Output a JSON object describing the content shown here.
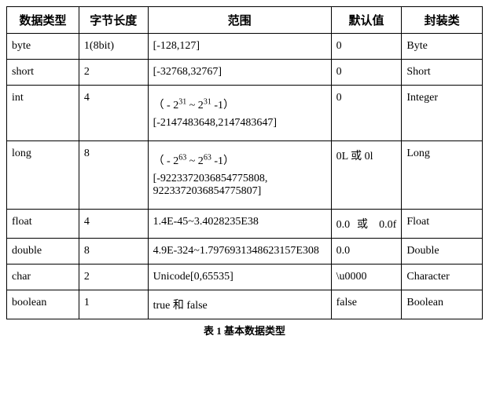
{
  "chart_data": {
    "type": "table",
    "title": "表 1  基本数据类型",
    "columns": [
      "数据类型",
      "字节长度",
      "范围",
      "默认值",
      "封装类"
    ],
    "rows": [
      {
        "type": "byte",
        "bytes": "1(8bit)",
        "range": "[-128,127]",
        "default": "0",
        "wrapper": "Byte"
      },
      {
        "type": "short",
        "bytes": "2",
        "range": "[-32768,32767]",
        "default": "0",
        "wrapper": "Short"
      },
      {
        "type": "int",
        "bytes": "4",
        "range_formula": "( - 2^31 ~ 2^31 -1)",
        "range_literal": "[-2147483648,2147483647]",
        "default": "0",
        "wrapper": "Integer"
      },
      {
        "type": "long",
        "bytes": "8",
        "range_formula": "( - 2^63 ~ 2^63  -1)",
        "range_literal": "[-9223372036854775808, 9223372036854775807]",
        "default": "0L 或 0l",
        "wrapper": "Long"
      },
      {
        "type": "float",
        "bytes": "4",
        "range": "1.4E-45~3.4028235E38",
        "default": "0.0 或 0.0f",
        "wrapper": "Float"
      },
      {
        "type": "double",
        "bytes": "8",
        "range": "4.9E-324~1.7976931348623157E308",
        "default": "0.0",
        "wrapper": "Double"
      },
      {
        "type": "char",
        "bytes": "2",
        "range": "Unicode[0,65535]",
        "default": "\\u0000",
        "wrapper": "Character"
      },
      {
        "type": "boolean",
        "bytes": "1",
        "range": "true 和 false",
        "default": "false",
        "wrapper": "Boolean"
      }
    ]
  },
  "headers": {
    "c0": "数据类型",
    "c1": "字节长度",
    "c2": "范围",
    "c3": "默认值",
    "c4": "封装类"
  },
  "rows": {
    "byte": {
      "type": "byte",
      "bytes": "1(8bit)",
      "range": "[-128,127]",
      "default": "0",
      "wrapper": "Byte"
    },
    "short": {
      "type": "short",
      "bytes": "2",
      "range": "[-32768,32767]",
      "default": "0",
      "wrapper": "Short"
    },
    "int": {
      "type": "int",
      "bytes": "4",
      "range_prefix": "（ - 2",
      "range_exp1": "31",
      "range_mid": " ~ 2",
      "range_exp2": "31",
      "range_suffix": " -1）",
      "range_literal": "[-2147483648,2147483647]",
      "default": "0",
      "wrapper": "Integer"
    },
    "long": {
      "type": "long",
      "bytes": "8",
      "range_prefix": "（ - 2",
      "range_exp1": "63",
      "range_mid": " ~ 2",
      "range_exp2": "63",
      "range_suffix": "  -1）",
      "range_literal": "[-9223372036854775808, 9223372036854775807]",
      "default": "0L 或 0l",
      "wrapper": "Long"
    },
    "float": {
      "type": "float",
      "bytes": "4",
      "range": "1.4E-45~3.4028235E38",
      "default": "0.0  或 0.0f",
      "wrapper": "Float"
    },
    "double": {
      "type": "double",
      "bytes": "8",
      "range": "4.9E-324~1.7976931348623157E308",
      "default": "0.0",
      "wrapper": "Double"
    },
    "char": {
      "type": "char",
      "bytes": "2",
      "range": "Unicode[0,65535]",
      "default": "\\u0000",
      "wrapper": "Character"
    },
    "boolean": {
      "type": "boolean",
      "bytes": "1",
      "range": "true 和 false",
      "default": "false",
      "wrapper": "Boolean"
    }
  },
  "caption": "表 1  基本数据类型"
}
